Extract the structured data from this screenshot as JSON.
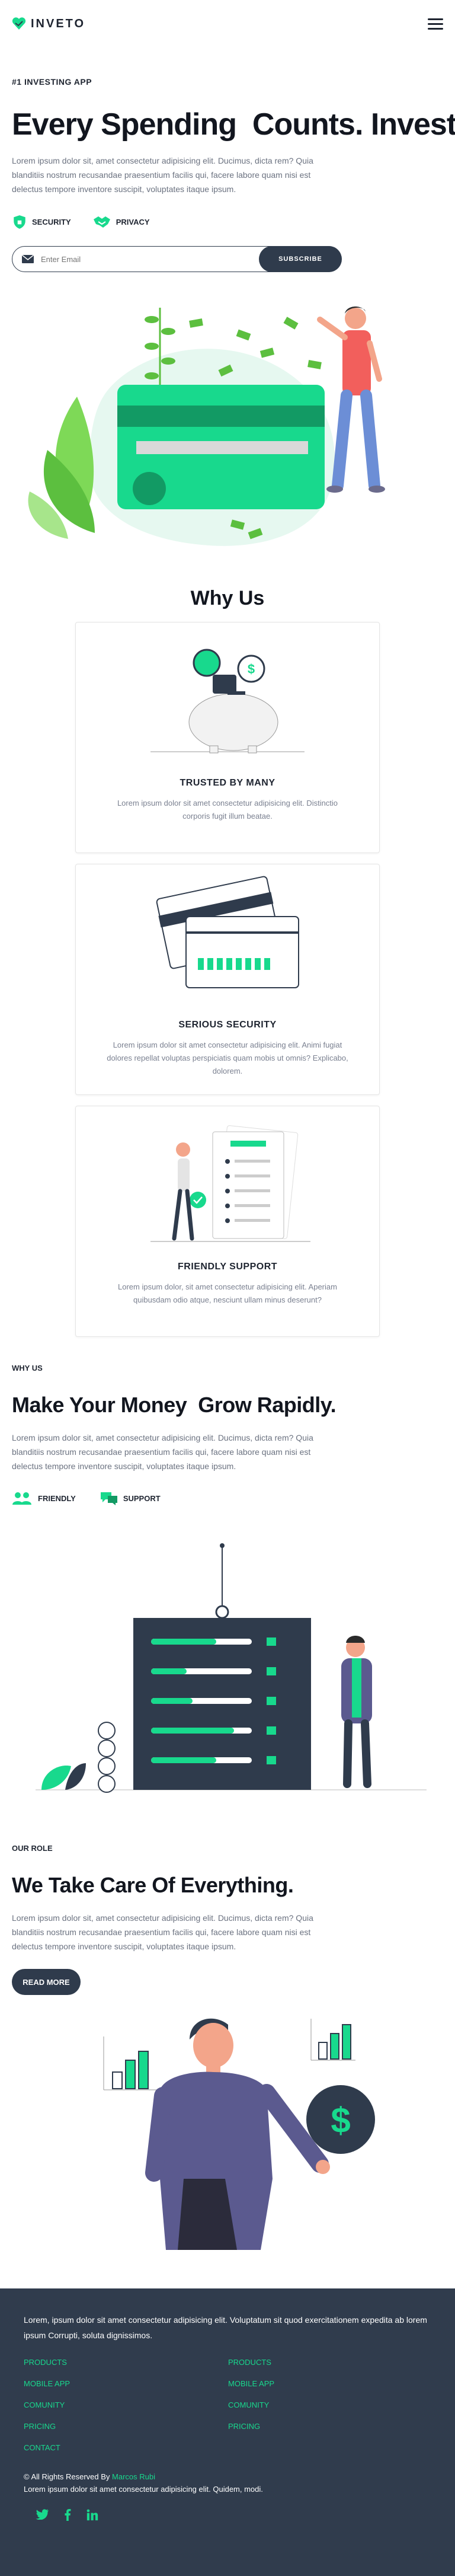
{
  "nav": {
    "brand": "INVETO",
    "logo_icon": "heart-icon",
    "menu_icon": "hamburger-icon"
  },
  "hero": {
    "eyebrow": "#1 INVESTING APP",
    "title": "Every Spending  Counts. Invest It.",
    "lead": "Lorem ipsum dolor sit, amet consectetur adipisicing elit. Ducimus, dicta rem? Quia blanditiis nostrum recusandae praesentium facilis qui, facere labore quam nisi est delectus tempore inventore suscipit, voluptates itaque ipsum.",
    "badges": [
      {
        "label": "SECURITY",
        "icon": "shield-icon"
      },
      {
        "label": "PRIVACY",
        "icon": "handshake-icon"
      }
    ],
    "subscribe": {
      "placeholder": "Enter Email",
      "button": "SUBSCRIBE",
      "icon": "envelope-icon"
    }
  },
  "why_us": {
    "title": "Why Us",
    "cards": [
      {
        "title": "TRUSTED BY MANY",
        "text": "Lorem ipsum dolor sit amet consectetur adipisicing elit. Distinctio corporis fugit illum beatae."
      },
      {
        "title": "SERIOUS SECURITY",
        "text": "Lorem ipsum dolor sit amet consectetur adipisicing elit. Animi fugiat dolores repellat voluptas perspiciatis quam mobis ut omnis? Explicabo, dolorem."
      },
      {
        "title": "FRIENDLY SUPPORT",
        "text": "Lorem ipsum dolor, sit amet consectetur adipisicing elit. Aperiam quibusdam odio atque, nesciunt ullam minus deserunt?"
      }
    ]
  },
  "grow": {
    "eyebrow": "WHY US",
    "title": "Make Your Money  Grow Rapidly.",
    "lead": "Lorem ipsum dolor sit, amet consectetur adipisicing elit. Ducimus, dicta rem? Quia blanditiis nostrum recusandae praesentium facilis qui, facere labore quam nisi est delectus tempore inventore suscipit, voluptates itaque ipsum.",
    "badges": [
      {
        "label": "FRIENDLY",
        "icon": "users-icon"
      },
      {
        "label": "SUPPORT",
        "icon": "chat-icon"
      }
    ]
  },
  "role": {
    "eyebrow": "OUR ROLE",
    "title": "We Take Care Of Everything.",
    "lead": "Lorem ipsum dolor sit, amet consectetur adipisicing elit. Ducimus, dicta rem? Quia blanditiis nostrum recusandae praesentium facilis qui, facere labore quam nisi est delectus tempore inventore suscipit, voluptates itaque ipsum.",
    "button": "READ MORE"
  },
  "footer": {
    "intro": "Lorem, ipsum dolor sit amet consectetur adipisicing elit. Voluptatum sit quod exercitationem expedita ab lorem ipsum Corrupti, soluta dignissimos.",
    "links_left": [
      "PRODUCTS",
      "MOBILE APP",
      "COMUNITY",
      "PRICING",
      "CONTACT"
    ],
    "links_right": [
      "PRODUCTS",
      "MOBILE APP",
      "COMUNITY",
      "PRICING"
    ],
    "copyright": "© All Rights Reserved By",
    "author": "Marcos Rubi",
    "tagline": "Lorem ipsum dolor sit amet consectetur adipisicing elit. Quidem, modi.",
    "socials": [
      "twitter-icon",
      "facebook-icon",
      "linkedin-icon"
    ]
  },
  "colors": {
    "accent": "#18d98d",
    "dark": "#2f3b4c",
    "footer_bg": "#303c4d",
    "text": "#1e2430"
  }
}
